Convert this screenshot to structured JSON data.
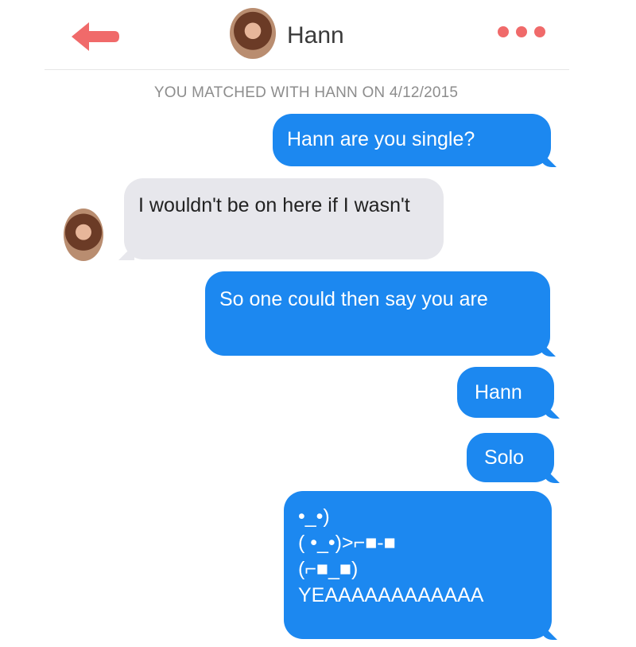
{
  "header": {
    "contact_name": "Hann",
    "back_icon": "back-arrow-icon",
    "more_icon": "more-dots-icon",
    "accent_color": "#f06a6a"
  },
  "match_banner": "YOU MATCHED WITH HANN ON 4/12/2015",
  "messages": [
    {
      "from": "me",
      "text": "Hann are you single?"
    },
    {
      "from": "them",
      "text": "I wouldn't be on here if I wasn't"
    },
    {
      "from": "me",
      "text": "So one could then say you are"
    },
    {
      "from": "me",
      "text": "Hann"
    },
    {
      "from": "me",
      "text": "Solo"
    },
    {
      "from": "me",
      "lines": [
        "•_•)",
        "( •_•)>⌐■-■",
        "(⌐■_■)",
        "YEAAAAAAAAAAAA"
      ]
    }
  ],
  "colors": {
    "sent_bubble": "#1c88f0",
    "received_bubble": "#e7e7ec"
  }
}
